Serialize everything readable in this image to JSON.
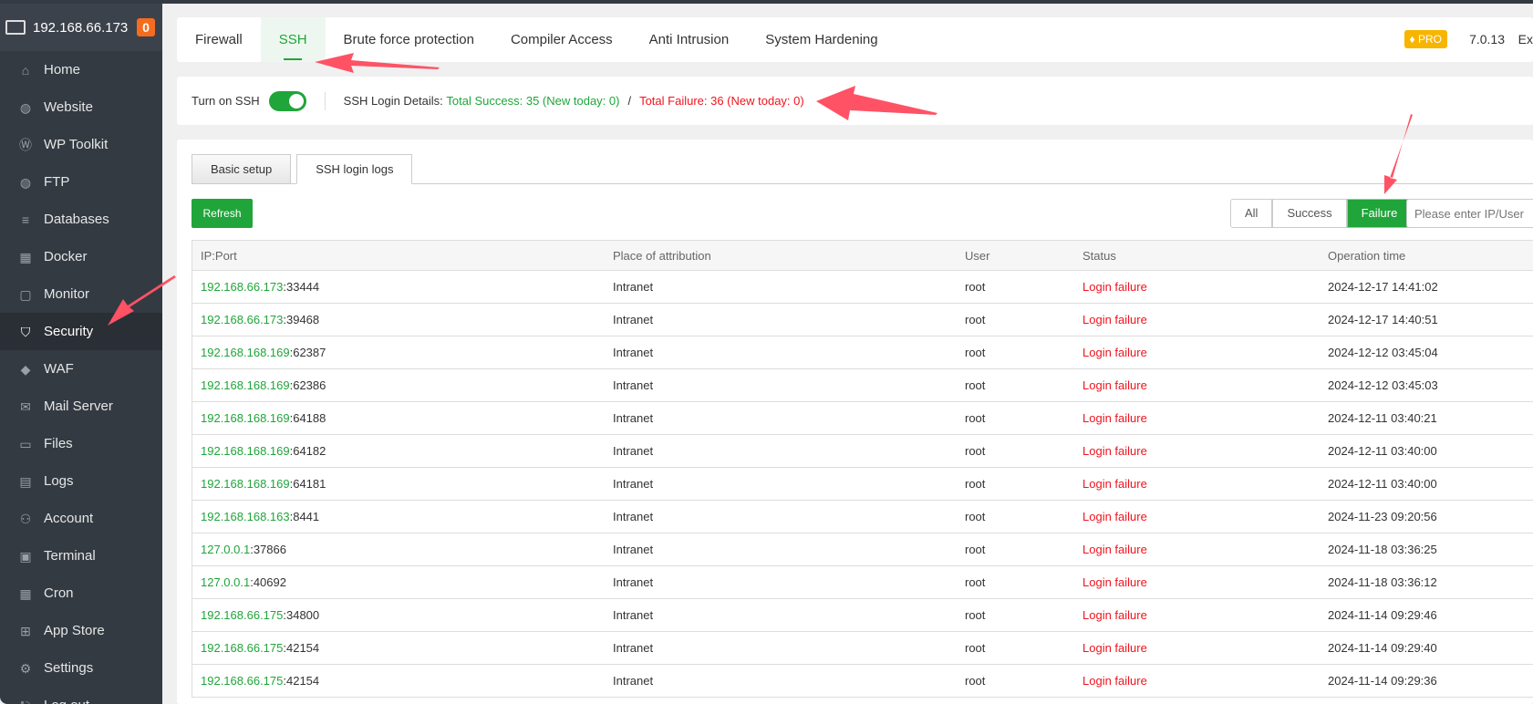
{
  "server": {
    "ip": "192.168.66.173",
    "badge": "0"
  },
  "sidebar": {
    "items": [
      {
        "label": "Home",
        "icon": "home-icon",
        "glyph": "⌂"
      },
      {
        "label": "Website",
        "icon": "globe-icon",
        "glyph": "◍"
      },
      {
        "label": "WP Toolkit",
        "icon": "wordpress-icon",
        "glyph": "Ⓦ"
      },
      {
        "label": "FTP",
        "icon": "ftp-icon",
        "glyph": "◍"
      },
      {
        "label": "Databases",
        "icon": "database-icon",
        "glyph": "≡"
      },
      {
        "label": "Docker",
        "icon": "docker-icon",
        "glyph": "▦"
      },
      {
        "label": "Monitor",
        "icon": "monitor-icon",
        "glyph": "▢"
      },
      {
        "label": "Security",
        "icon": "shield-icon",
        "glyph": "⛉"
      },
      {
        "label": "WAF",
        "icon": "waf-shield-icon",
        "glyph": "◆"
      },
      {
        "label": "Mail Server",
        "icon": "mail-icon",
        "glyph": "✉"
      },
      {
        "label": "Files",
        "icon": "folder-icon",
        "glyph": "▭"
      },
      {
        "label": "Logs",
        "icon": "logs-icon",
        "glyph": "▤"
      },
      {
        "label": "Account",
        "icon": "user-icon",
        "glyph": "⚇"
      },
      {
        "label": "Terminal",
        "icon": "terminal-icon",
        "glyph": "▣"
      },
      {
        "label": "Cron",
        "icon": "calendar-icon",
        "glyph": "▦"
      },
      {
        "label": "App Store",
        "icon": "apps-icon",
        "glyph": "⊞"
      },
      {
        "label": "Settings",
        "icon": "gear-icon",
        "glyph": "⚙"
      },
      {
        "label": "Log out",
        "icon": "logout-icon",
        "glyph": "⎋"
      }
    ]
  },
  "tabs": [
    "Firewall",
    "SSH",
    "Brute force protection",
    "Compiler Access",
    "Anti Intrusion",
    "System Hardening"
  ],
  "header": {
    "pro": "PRO",
    "version": "7.0.13",
    "extra": "Ex"
  },
  "ssh": {
    "toggle_label": "Turn on SSH",
    "details_label": "SSH Login Details:",
    "success": "Total Success: 35 (New today: 0)",
    "separator": "/",
    "failure": "Total Failure: 36 (New today: 0)",
    "enabled": true
  },
  "subtabs": [
    "Basic setup",
    "SSH login logs"
  ],
  "toolbar": {
    "refresh": "Refresh",
    "filters": [
      "All",
      "Success",
      "Failure"
    ],
    "search_placeholder": "Please enter IP/User"
  },
  "colors": {
    "accent": "#20a53a",
    "failure": "#f0141e"
  },
  "table": {
    "headers": [
      "IP:Port",
      "Place of attribution",
      "User",
      "Status",
      "Operation time"
    ],
    "rows": [
      {
        "ip": "192.168.66.173",
        "port": ":33444",
        "place": "Intranet",
        "user": "root",
        "status": "Login failure",
        "time": "2024-12-17 14:41:02"
      },
      {
        "ip": "192.168.66.173",
        "port": ":39468",
        "place": "Intranet",
        "user": "root",
        "status": "Login failure",
        "time": "2024-12-17 14:40:51"
      },
      {
        "ip": "192.168.168.169",
        "port": ":62387",
        "place": "Intranet",
        "user": "root",
        "status": "Login failure",
        "time": "2024-12-12 03:45:04"
      },
      {
        "ip": "192.168.168.169",
        "port": ":62386",
        "place": "Intranet",
        "user": "root",
        "status": "Login failure",
        "time": "2024-12-12 03:45:03"
      },
      {
        "ip": "192.168.168.169",
        "port": ":64188",
        "place": "Intranet",
        "user": "root",
        "status": "Login failure",
        "time": "2024-12-11 03:40:21"
      },
      {
        "ip": "192.168.168.169",
        "port": ":64182",
        "place": "Intranet",
        "user": "root",
        "status": "Login failure",
        "time": "2024-12-11 03:40:00"
      },
      {
        "ip": "192.168.168.169",
        "port": ":64181",
        "place": "Intranet",
        "user": "root",
        "status": "Login failure",
        "time": "2024-12-11 03:40:00"
      },
      {
        "ip": "192.168.168.163",
        "port": ":8441",
        "place": "Intranet",
        "user": "root",
        "status": "Login failure",
        "time": "2024-11-23 09:20:56"
      },
      {
        "ip": "127.0.0.1",
        "port": ":37866",
        "place": "Intranet",
        "user": "root",
        "status": "Login failure",
        "time": "2024-11-18 03:36:25"
      },
      {
        "ip": "127.0.0.1",
        "port": ":40692",
        "place": "Intranet",
        "user": "root",
        "status": "Login failure",
        "time": "2024-11-18 03:36:12"
      },
      {
        "ip": "192.168.66.175",
        "port": ":34800",
        "place": "Intranet",
        "user": "root",
        "status": "Login failure",
        "time": "2024-11-14 09:29:46"
      },
      {
        "ip": "192.168.66.175",
        "port": ":42154",
        "place": "Intranet",
        "user": "root",
        "status": "Login failure",
        "time": "2024-11-14 09:29:40"
      },
      {
        "ip": "192.168.66.175",
        "port": ":42154",
        "place": "Intranet",
        "user": "root",
        "status": "Login failure",
        "time": "2024-11-14 09:29:36"
      }
    ]
  }
}
